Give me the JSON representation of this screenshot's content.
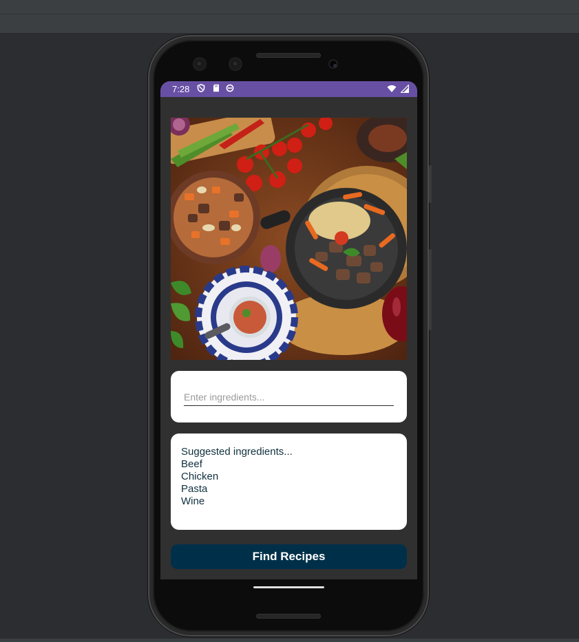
{
  "status_bar": {
    "time": "7:28",
    "left_icons": [
      "shield-icon",
      "sd-card-icon",
      "sync-icon"
    ],
    "right_icons": [
      "wifi-icon",
      "signal-icon"
    ],
    "color": "#6750a4"
  },
  "hero_image": {
    "subject": "food-spread-image"
  },
  "ingredient_input": {
    "placeholder": "Enter ingredients...",
    "value": ""
  },
  "suggestions": {
    "header": "Suggested ingredients...",
    "items": [
      "Beef",
      "Chicken",
      "Pasta",
      "Wine"
    ]
  },
  "find_button": {
    "label": "Find Recipes",
    "color": "#003049"
  },
  "theme": {
    "screen_bg": "#303030",
    "card_bg": "#ffffff",
    "text": "#10303e"
  }
}
